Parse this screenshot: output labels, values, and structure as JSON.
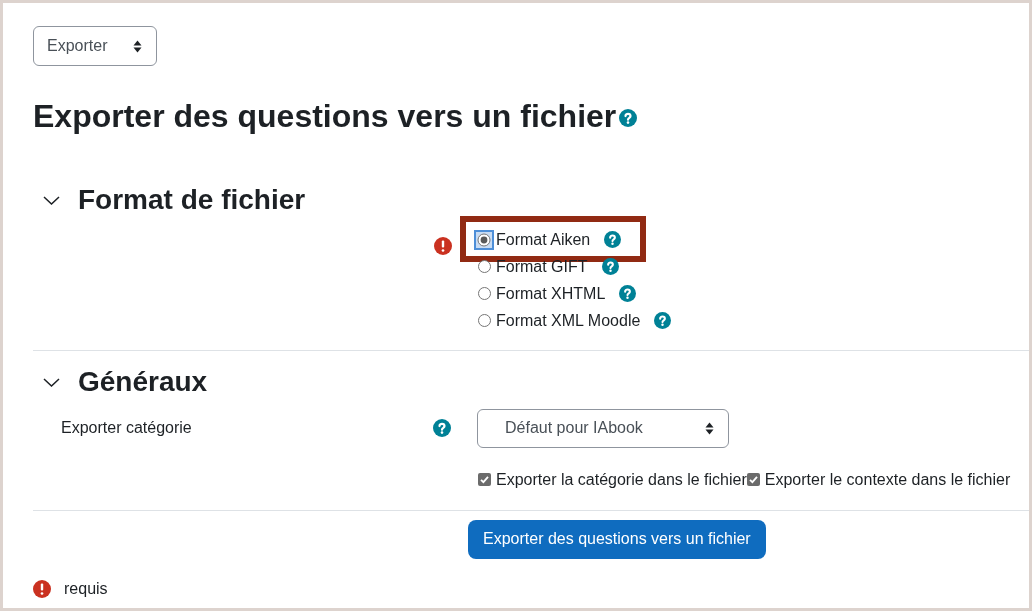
{
  "action_menu": {
    "value": "Exporter"
  },
  "page_title": "Exporter des questions vers un fichier",
  "sections": [
    {
      "kind": "radio_group",
      "title": "Format de fichier",
      "expanded": true,
      "required": true,
      "options": [
        {
          "label": "Format Aiken",
          "selected": true,
          "focused": true,
          "annotated": true
        },
        {
          "label": "Format GIFT",
          "selected": false,
          "focused": false,
          "annotated": false
        },
        {
          "label": "Format XHTML",
          "selected": false,
          "focused": false,
          "annotated": false
        },
        {
          "label": "Format XML Moodle",
          "selected": false,
          "focused": false,
          "annotated": false
        }
      ]
    },
    {
      "kind": "fields",
      "title": "Généraux",
      "expanded": true,
      "fields": [
        {
          "kind": "select",
          "label": "Exporter catégorie",
          "value": "Défaut pour IAbook"
        },
        {
          "kind": "checkboxes",
          "items": [
            {
              "label": "Exporter la catégorie dans le fichier",
              "checked": true
            },
            {
              "label": "Exporter le contexte dans le fichier",
              "checked": true
            }
          ]
        }
      ]
    }
  ],
  "submit_button": {
    "label": "Exporter des questions vers un fichier"
  },
  "legend": {
    "text": "requis"
  }
}
